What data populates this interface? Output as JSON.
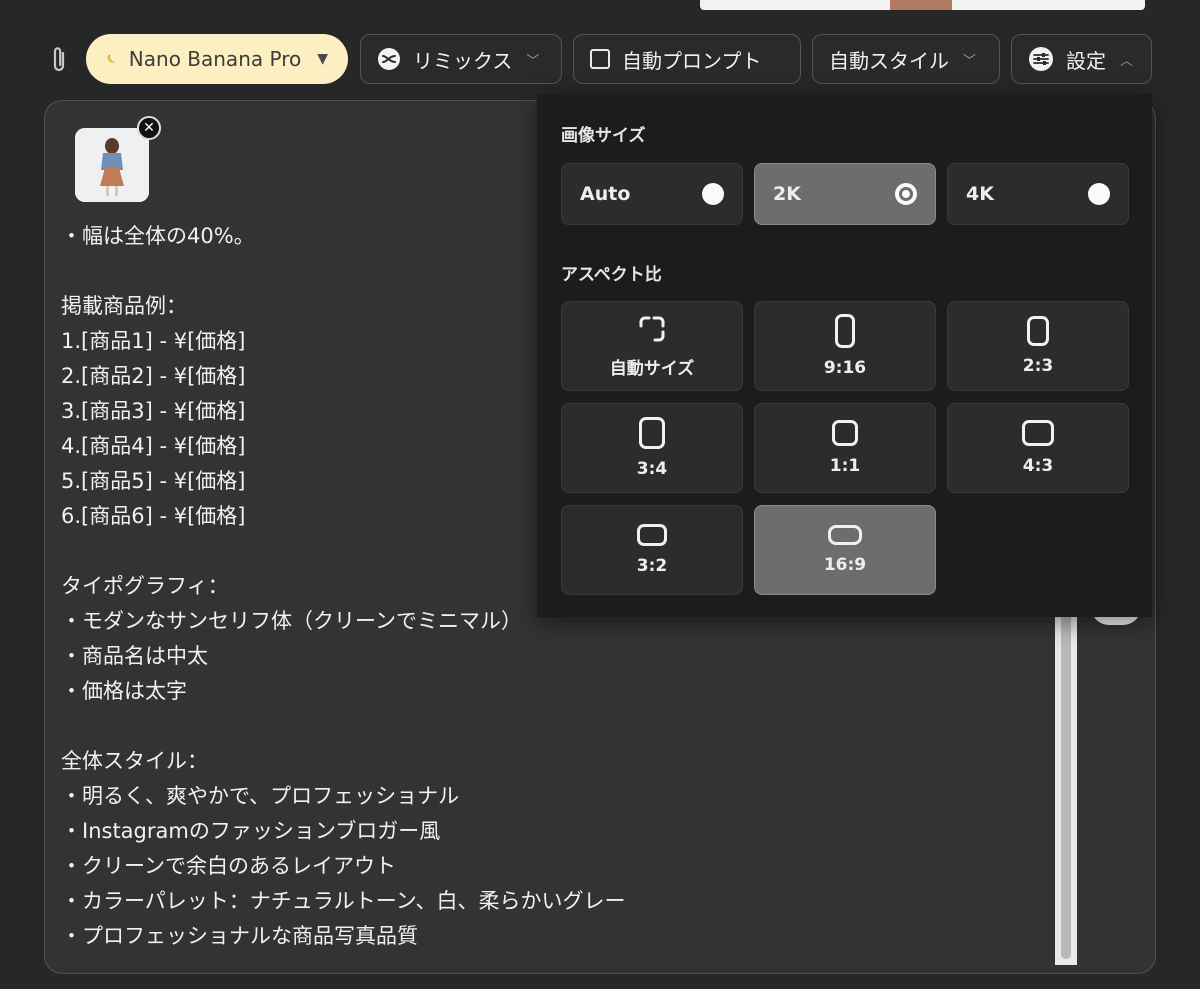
{
  "toolbar": {
    "model_label": "Nano Banana Pro",
    "remix_label": "リミックス",
    "auto_prompt_label": "自動プロンプト",
    "auto_prompt_checked": false,
    "auto_style_label": "自動スタイル",
    "settings_label": "設定"
  },
  "prompt": {
    "text": "・幅は全体の40%。\n\n掲載商品例：\n1.[商品1] - ¥[価格]\n2.[商品2] - ¥[価格]\n3.[商品3] - ¥[価格]\n4.[商品4] - ¥[価格]\n5.[商品5] - ¥[価格]\n6.[商品6] - ¥[価格]\n\nタイポグラフィ：\n・モダンなサンセリフ体（クリーンでミニマル）\n・商品名は中太\n・価格は太字\n\n全体スタイル：\n・明るく、爽やかで、プロフェッショナル\n・Instagramのファッションブロガー風\n・クリーンで余白のあるレイアウト\n・カラーパレット：ナチュラルトーン、白、柔らかいグレー\n・プロフェッショナルな商品写真品質"
  },
  "settings_panel": {
    "image_size_label": "画像サイズ",
    "image_sizes": [
      {
        "label": "Auto",
        "selected": false
      },
      {
        "label": "2K",
        "selected": true
      },
      {
        "label": "4K",
        "selected": false
      }
    ],
    "aspect_label": "アスペクト比",
    "aspect_ratios": [
      {
        "label": "自動サイズ",
        "selected": false
      },
      {
        "label": "9:16",
        "selected": false
      },
      {
        "label": "2:3",
        "selected": false
      },
      {
        "label": "3:4",
        "selected": false
      },
      {
        "label": "1:1",
        "selected": false
      },
      {
        "label": "4:3",
        "selected": false
      },
      {
        "label": "3:2",
        "selected": false
      },
      {
        "label": "16:9",
        "selected": true
      }
    ]
  },
  "icons": {
    "attach": "paperclip-icon",
    "model": "banana-icon",
    "remix": "shuffle-icon",
    "settings": "sliders-icon",
    "close": "close-icon",
    "auto_size": "resize-corners-icon"
  }
}
